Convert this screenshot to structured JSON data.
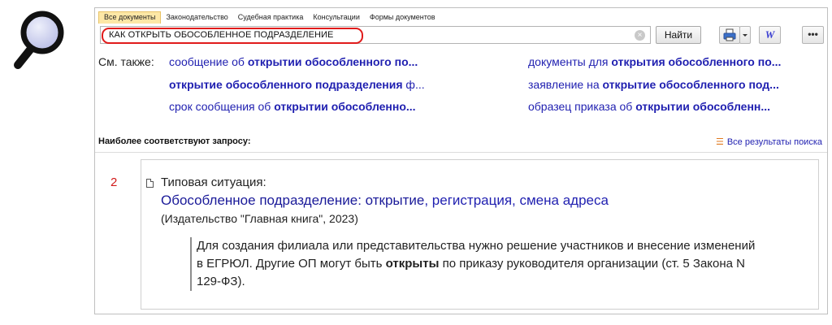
{
  "icons": {
    "magnifier": "search-magnifier-illustration",
    "clear": "clear-icon",
    "print": "printer-icon",
    "dropdown": "chevron-down-icon",
    "word": "word-icon",
    "more": "more-icon",
    "all_results": "list-icon",
    "document": "document-icon"
  },
  "colors": {
    "link": "#1f1fb0",
    "highlight_ring": "#e01b1b",
    "active_tab": "#fde7a6",
    "result_number": "#d11a1a"
  },
  "tabs": [
    {
      "label": "Все документы",
      "active": true
    },
    {
      "label": "Законодательство",
      "active": false
    },
    {
      "label": "Судебная практика",
      "active": false
    },
    {
      "label": "Консультации",
      "active": false
    },
    {
      "label": "Формы документов",
      "active": false
    }
  ],
  "search": {
    "value": "КАК ОТКРЫТЬ ОБОСОБЛЕННОЕ ПОДРАЗДЕЛЕНИЕ",
    "find_label": "Найти",
    "word_label": "W",
    "more_label": "•••"
  },
  "see_also": {
    "label": "См. также:",
    "items": [
      {
        "pre": "сообщение об ",
        "bold": "открытии обособленного по...",
        "post": ""
      },
      {
        "pre": "",
        "bold": "открытие обособленного подразделения",
        "post": " ф..."
      },
      {
        "pre": "срок сообщения об ",
        "bold": "открытии обособленно...",
        "post": ""
      },
      {
        "pre": "документы для ",
        "bold": "открытия обособленного по...",
        "post": ""
      },
      {
        "pre": "заявление на ",
        "bold": "открытие обособленного под...",
        "post": ""
      },
      {
        "pre": "образец приказа об ",
        "bold": "открытии обособленн...",
        "post": ""
      }
    ]
  },
  "results": {
    "header": "Наиболее соответствуют запросу:",
    "all_results_label": "Все результаты поиска",
    "item": {
      "number": "2",
      "type": "Типовая ситуация:",
      "title_part1": "Обособленное подразделение",
      "title_sep": ": ",
      "title_part2": "открытие",
      "title_rest": ", регистрация, смена адреса",
      "source": "(Издательство \"Главная книга\", 2023)",
      "snippet_pre": "Для создания филиала или представительства нужно решение участников и внесение изменений в ЕГРЮЛ. Другие ОП могут быть ",
      "snippet_bold": "открыты",
      "snippet_post": " по приказу руководителя организации (ст. 5 Закона N 129-ФЗ)."
    }
  }
}
